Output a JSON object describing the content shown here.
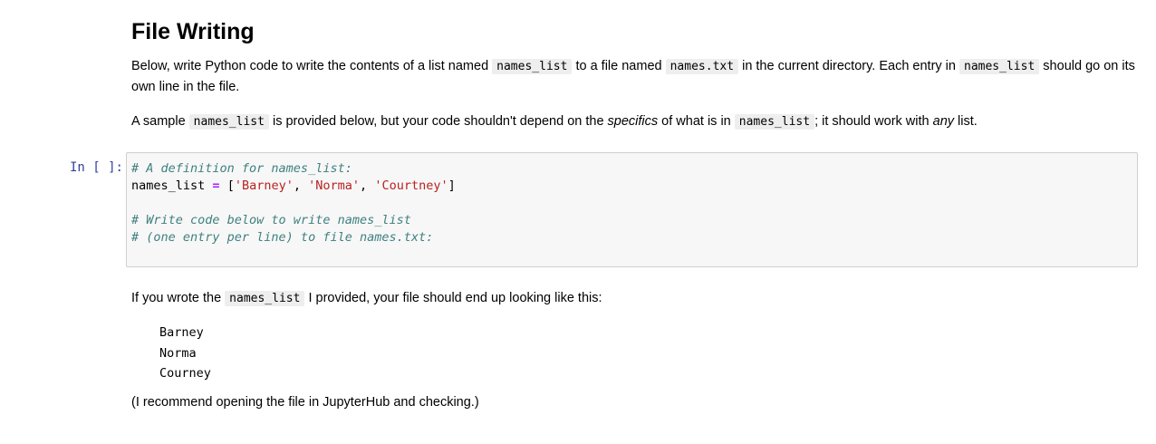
{
  "markdown_intro": {
    "heading": "File Writing",
    "para1": {
      "t1": "Below, write Python code to write the contents of a list named ",
      "c1": "names_list",
      "t2": " to a file named ",
      "c2": "names.txt",
      "t3": " in the current directory. Each entry in ",
      "c3": "names_list",
      "t4": " should go on its own line in the file."
    },
    "para2": {
      "t1": "A sample ",
      "c1": "names_list",
      "t2": " is provided below, but your code shouldn't depend on the ",
      "em1": "specifics",
      "t3": " of what is in ",
      "c2": "names_list",
      "t4": "; it should work with ",
      "em2": "any",
      "t5": " list."
    }
  },
  "code_cell": {
    "prompt": "In [ ]:",
    "line1_comment": "# A definition for names_list:",
    "line2": {
      "var": "names_list",
      "eq": "=",
      "open": "[",
      "s1": "'Barney'",
      "comma1": ", ",
      "s2": "'Norma'",
      "comma2": ", ",
      "s3": "'Courtney'",
      "close": "]"
    },
    "line4_comment": "# Write code below to write names_list",
    "line5_comment": "# (one entry per line) to file names.txt:"
  },
  "markdown_result": {
    "para1": {
      "t1": "If you wrote the ",
      "c1": "names_list",
      "t2": " I provided, your file should end up looking like this:"
    },
    "file_lines": [
      "Barney",
      "Norma",
      "Courney"
    ],
    "para2": "(I recommend opening the file in JupyterHub and checking.)"
  }
}
